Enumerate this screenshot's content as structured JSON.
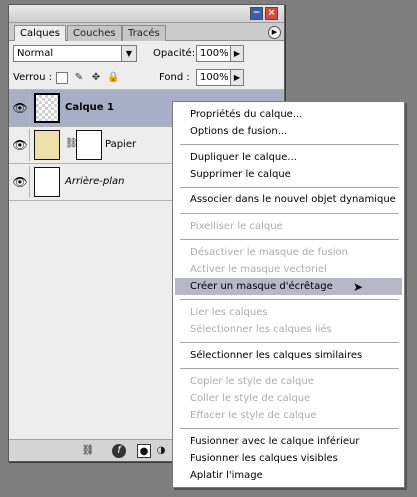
{
  "panel": {
    "tabs": [
      "Calques",
      "Couches",
      "Tracés"
    ],
    "blend_mode": "Normal",
    "opacity_label": "Opacité:",
    "opacity_value": "100%",
    "lock_label": "Verrou :",
    "fill_label": "Fond :",
    "fill_value": "100%",
    "icons": {
      "minimize": "minimize-icon",
      "close": "close-icon",
      "panel_menu": "panel-menu-icon",
      "lock_transparent": "lock-transparent-icon",
      "lock_paint": "brush-icon",
      "lock_move": "move-icon",
      "lock_all": "padlock-icon",
      "eye": "eye-icon",
      "link": "link-icon",
      "style": "fx-icon",
      "mask": "mask-icon",
      "adjust": "adjustment-icon"
    }
  },
  "layers": [
    {
      "name": "Calque 1",
      "selected": true,
      "thumb": "transparent"
    },
    {
      "name": "Papier",
      "selected": false,
      "thumb": "beige",
      "has_mask": true
    },
    {
      "name": "Arrière-plan",
      "selected": false,
      "thumb": "white",
      "italic": true
    }
  ],
  "context_menu": [
    {
      "label": "Propriétés du calque...",
      "enabled": true
    },
    {
      "label": "Options de fusion...",
      "enabled": true
    },
    {
      "label": "Dupliquer le calque...",
      "enabled": true
    },
    {
      "label": "Supprimer le calque",
      "enabled": true
    },
    {
      "label": "Associer dans le nouvel objet dynamique",
      "enabled": true
    },
    {
      "label": "Pixelliser le calque",
      "enabled": false
    },
    {
      "label": "Désactiver le masque de fusion",
      "enabled": false
    },
    {
      "label": "Activer le masque vectoriel",
      "enabled": false
    },
    {
      "label": "Créer un masque d'écrêtage",
      "enabled": true,
      "highlighted": true
    },
    {
      "label": "Lier les calques",
      "enabled": false
    },
    {
      "label": "Sélectionner les calques liés",
      "enabled": false
    },
    {
      "label": "Sélectionner les calques similaires",
      "enabled": true
    },
    {
      "label": "Copier le style de calque",
      "enabled": false
    },
    {
      "label": "Coller le style de calque",
      "enabled": false
    },
    {
      "label": "Effacer le style de calque",
      "enabled": false
    },
    {
      "label": "Fusionner avec le calque inférieur",
      "enabled": true
    },
    {
      "label": "Fusionner les calques visibles",
      "enabled": true
    },
    {
      "label": "Aplatir l'image",
      "enabled": true
    }
  ],
  "colors": {
    "selected_layer": "#a9aec7",
    "menu_highlight": "#b6b7c9",
    "disabled_text": "#acacac",
    "backdrop": "#7f7f7f"
  }
}
